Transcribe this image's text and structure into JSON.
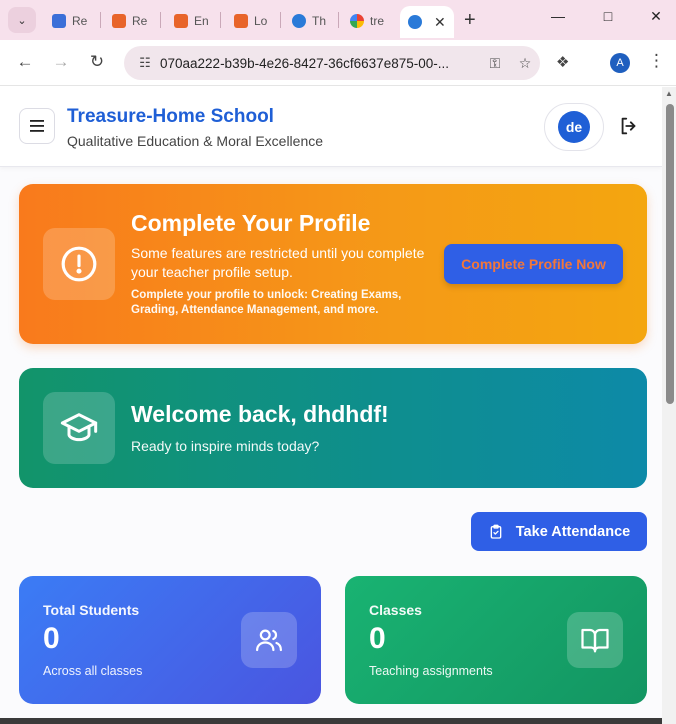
{
  "browser": {
    "tabs": [
      {
        "label": "Re",
        "favicon": "doc-icon",
        "color": "#3b6fd8"
      },
      {
        "label": "Re",
        "favicon": "flow-icon",
        "color": "#e8642a"
      },
      {
        "label": "En",
        "favicon": "flow-icon",
        "color": "#e8642a"
      },
      {
        "label": "Lo",
        "favicon": "flow-icon",
        "color": "#e8642a"
      },
      {
        "label": "Th",
        "favicon": "globe-icon",
        "color": "#2a7ad8"
      },
      {
        "label": "tre",
        "favicon": "google-icon",
        "color": "#4285f4"
      },
      {
        "label": "",
        "favicon": "globe-icon",
        "color": "#2a7ad8",
        "active": true
      }
    ],
    "url": "070aa222-b39b-4e26-8427-36cf6637e875-00-...",
    "profile_initial": "A"
  },
  "header": {
    "school_name": "Treasure-Home School",
    "tagline": "Qualitative Education & Moral Excellence",
    "avatar_initials": "de"
  },
  "profile_banner": {
    "title": "Complete Your Profile",
    "description": "Some features are restricted until you complete your teacher profile setup.",
    "note": "Complete your profile to unlock: Creating Exams, Grading, Attendance Management, and more.",
    "button_label": "Complete Profile Now"
  },
  "welcome_banner": {
    "title": "Welcome back, dhdhdf!",
    "subtitle": "Ready to inspire minds today?"
  },
  "actions": {
    "attendance_label": "Take Attendance"
  },
  "stats": [
    {
      "label": "Total Students",
      "value": "0",
      "sub": "Across all classes",
      "icon": "users-icon"
    },
    {
      "label": "Classes",
      "value": "0",
      "sub": "Teaching assignments",
      "icon": "book-icon"
    }
  ]
}
